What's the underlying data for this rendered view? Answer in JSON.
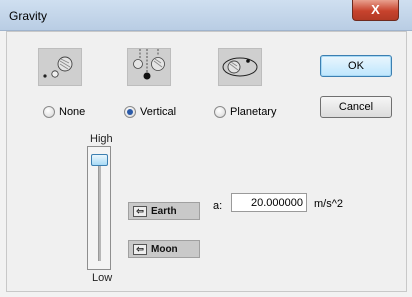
{
  "window": {
    "title": "Gravity",
    "close_glyph": "X"
  },
  "modes": [
    {
      "label": "None",
      "icon": "no-gravity-icon",
      "checked": false
    },
    {
      "label": "Vertical",
      "icon": "vertical-gravity-icon",
      "checked": true
    },
    {
      "label": "Planetary",
      "icon": "planetary-gravity-icon",
      "checked": false
    }
  ],
  "buttons": {
    "ok_label": "OK",
    "cancel_label": "Cancel"
  },
  "strength_slider": {
    "high_label": "High",
    "low_label": "Low",
    "level": 0.97
  },
  "presets": {
    "earth_label": "Earth",
    "moon_label": "Moon",
    "arrow_icon": "left-arrow-icon"
  },
  "acceleration": {
    "label": "a:",
    "value": "20.000000",
    "unit": "m/s^2"
  },
  "colors": {
    "titlebar": "#c4d6ea",
    "accent": "#3c7fb1",
    "close": "#c7432d"
  }
}
